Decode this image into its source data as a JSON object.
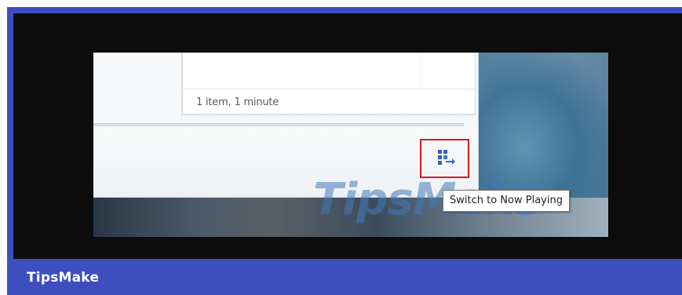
{
  "window": {
    "status_text": "1 item, 1 minute"
  },
  "controls": {
    "switch_button_icon": "switch-to-now-playing-icon"
  },
  "tooltip": {
    "text": "Switch to Now Playing"
  },
  "watermark": {
    "text": "TipsMake"
  },
  "footer": {
    "label": "TipsMake"
  },
  "colors": {
    "frame": "#3d4fbf",
    "background": "#0d0d0d",
    "highlight": "#d9191f"
  }
}
